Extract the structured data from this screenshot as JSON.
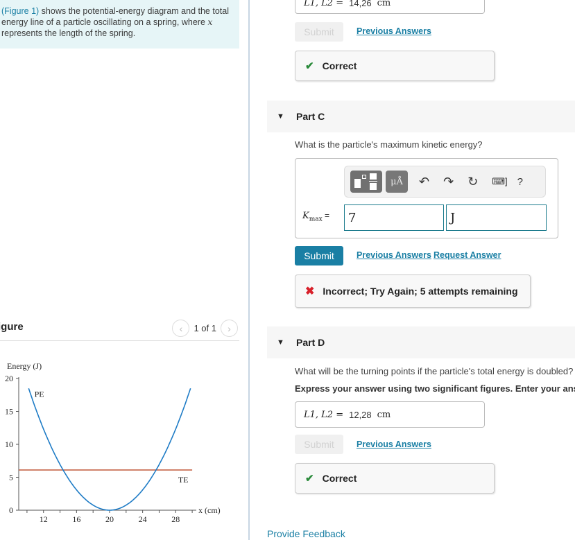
{
  "intro": {
    "figure_link": "(Figure 1)",
    "text_a": " shows the potential-energy diagram and the total energy line of a particle oscillating on a spring, where ",
    "var_x": "x",
    "text_b": " represents the length of the spring."
  },
  "figure_panel": {
    "title": "igure",
    "pager": "1 of 1",
    "prev_icon": "chevron-left-icon",
    "next_icon": "chevron-right-icon"
  },
  "part_b": {
    "answer_label": "L1, L2 =",
    "answer_value": "14,26",
    "answer_unit": "cm",
    "submit_label": "Submit",
    "prev_answers": "Previous Answers",
    "feedback": "Correct"
  },
  "part_c": {
    "header": "Part C",
    "question": "What is the particle's maximum kinetic energy?",
    "toolbar": {
      "template_icon": "fraction-template-icon",
      "units_label": "μÅ",
      "undo_icon": "undo-icon",
      "redo_icon": "redo-icon",
      "reset_icon": "reset-icon",
      "keyboard_icon": "keyboard-icon",
      "help_label": "?"
    },
    "input_label_main": "K",
    "input_label_sub": "max",
    "input_label_eq": " =",
    "value": "7",
    "unit": "J",
    "submit_label": "Submit",
    "prev_answers": "Previous Answers",
    "request_answer": "Request Answer",
    "feedback": "Incorrect; Try Again; 5 attempts remaining"
  },
  "part_d": {
    "header": "Part D",
    "question": "What will be the turning points if the particle's total energy is doubled?",
    "instruction": "Express your answer using two significant figures. Enter your ans",
    "answer_label": "L1, L2 =",
    "answer_value": "12,28",
    "answer_unit": "cm",
    "submit_label": "Submit",
    "prev_answers": "Previous Answers",
    "feedback": "Correct"
  },
  "footer": {
    "provide_feedback": "Provide Feedback"
  },
  "colors": {
    "accent": "#1a7fa4",
    "correct": "#2a8a3a",
    "incorrect": "#d8202a",
    "pe_curve": "#1f7cc6",
    "te_line": "#c0583a"
  },
  "chart_data": {
    "type": "line",
    "title": "",
    "ylabel": "Energy (J)",
    "xlabel": "x (cm)",
    "xlim": [
      9,
      31
    ],
    "ylim": [
      0,
      20
    ],
    "xticks": [
      12,
      16,
      20,
      24,
      28
    ],
    "yticks": [
      0,
      5,
      10,
      15,
      20
    ],
    "series": [
      {
        "name": "PE",
        "type": "parabola",
        "vertex_x": 20,
        "vertex_y": 0,
        "x_range": [
          10.2,
          29.8
        ],
        "points": [
          [
            10.2,
            18.5
          ],
          [
            14.2,
            6.1
          ],
          [
            20,
            0
          ],
          [
            25.8,
            6.1
          ],
          [
            29.8,
            18.5
          ]
        ]
      },
      {
        "name": "TE",
        "type": "hline",
        "y": 6.1,
        "x_range": [
          9,
          30
        ]
      }
    ],
    "annotations": [
      "PE",
      "TE"
    ]
  }
}
